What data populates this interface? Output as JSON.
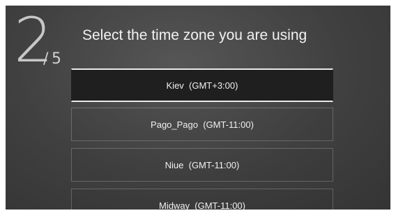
{
  "step": {
    "current": "2",
    "total": "5"
  },
  "title": "Select the time zone you are using",
  "time_zones": [
    {
      "label": "Kiev  (GMT+3:00)",
      "selected": true
    },
    {
      "label": "Pago_Pago  (GMT-11:00)",
      "selected": false
    },
    {
      "label": "Niue  (GMT-11:00)",
      "selected": false
    },
    {
      "label": "Midway  (GMT-11:00)",
      "selected": false
    }
  ]
}
